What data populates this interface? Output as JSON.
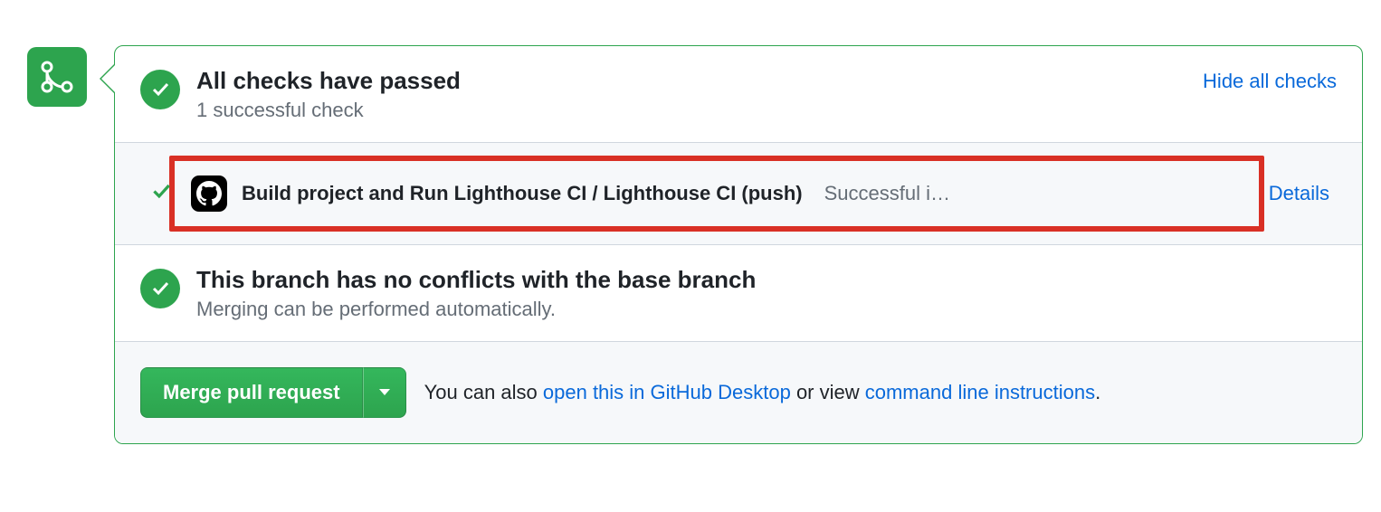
{
  "checks": {
    "title": "All checks have passed",
    "subtitle": "1 successful check",
    "hide_link": "Hide all checks",
    "items": [
      {
        "name": "Build project and Run Lighthouse CI / Lighthouse CI (push)",
        "status": "Successful i…",
        "details_label": "Details"
      }
    ]
  },
  "conflicts": {
    "title": "This branch has no conflicts with the base branch",
    "subtitle": "Merging can be performed automatically."
  },
  "merge": {
    "button_label": "Merge pull request",
    "hint_prefix": "You can also ",
    "desktop_link": "open this in GitHub Desktop",
    "hint_mid": " or view ",
    "cli_link": "command line instructions",
    "hint_suffix": "."
  }
}
